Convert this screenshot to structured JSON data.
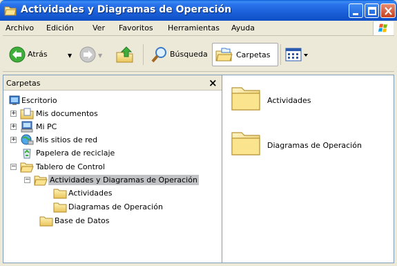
{
  "window": {
    "title": "Actividades y Diagramas de Operación",
    "app_icon": "folder-icon"
  },
  "menu": [
    "Archivo",
    "Edición",
    "Ver",
    "Favoritos",
    "Herramientas",
    "Ayuda"
  ],
  "toolbar": {
    "back_label": "Atrás",
    "search_label": "Búsqueda",
    "folders_label": "Carpetas"
  },
  "folders_pane": {
    "title": "Carpetas",
    "close_glyph": "×",
    "tree": [
      {
        "label": "Escritorio",
        "icon": "desktop-icon"
      },
      {
        "label": "Mis documentos",
        "icon": "documents-folder-icon"
      },
      {
        "label": "Mi PC",
        "icon": "computer-icon"
      },
      {
        "label": "Mis sitios de red",
        "icon": "network-icon"
      },
      {
        "label": "Papelera de reciclaje",
        "icon": "recycle-bin-icon"
      },
      {
        "label": "Tablero de Control",
        "icon": "folder-open-icon"
      },
      {
        "label": "Actividades y Diagramas de Operación",
        "icon": "folder-open-icon",
        "selected": true
      },
      {
        "label": "Actividades",
        "icon": "folder-icon"
      },
      {
        "label": "Diagramas de Operación",
        "icon": "folder-icon"
      },
      {
        "label": "Base de Datos",
        "icon": "folder-icon"
      }
    ]
  },
  "content": {
    "items": [
      {
        "label": "Actividades",
        "icon": "folder-icon"
      },
      {
        "label": "Diagramas de Operación",
        "icon": "folder-icon"
      }
    ]
  },
  "colors": {
    "titlebar": "#1a5fd8",
    "folder": "#f5d77a",
    "selection": "#c1c2c5"
  }
}
